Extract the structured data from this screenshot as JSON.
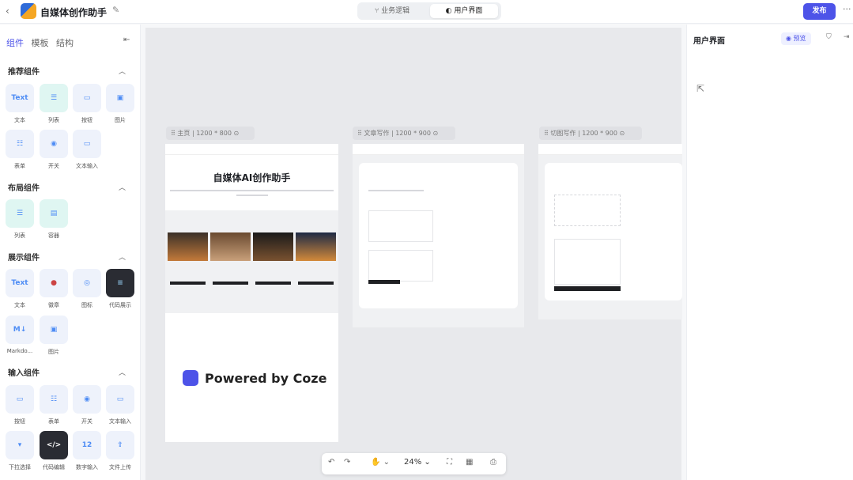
{
  "header": {
    "app_title": "自媒体创作助手",
    "view_tabs": [
      {
        "label": "业务逻辑"
      },
      {
        "label": "用户界面"
      }
    ],
    "publish_label": "发布"
  },
  "panel": {
    "tabs": [
      "组件",
      "模板",
      "结构"
    ],
    "sections": [
      {
        "title": "推荐组件",
        "items": [
          "文本",
          "列表",
          "按钮",
          "图片",
          "表单",
          "开关",
          "文本输入"
        ]
      },
      {
        "title": "布局组件",
        "items": [
          "列表",
          "容器"
        ]
      },
      {
        "title": "展示组件",
        "items": [
          "文本",
          "徽章",
          "图标",
          "代码展示",
          "Markdo...",
          "图片"
        ]
      },
      {
        "title": "输入组件",
        "items": [
          "按钮",
          "表单",
          "开关",
          "文本输入",
          "下拉选择",
          "代码编辑",
          "数字输入",
          "文件上传"
        ]
      }
    ]
  },
  "frames": [
    {
      "name": "主页",
      "size": "1200 * 800",
      "heading": "自媒体AI创作助手",
      "watermark": "Powered by Coze"
    },
    {
      "name": "文章写作",
      "size": "1200 * 900"
    },
    {
      "name": "切图写作",
      "size": "1200 * 900"
    }
  ],
  "right_panel": {
    "title": "用户界面",
    "preview_label": "预览"
  },
  "zoom": {
    "level": "24%"
  }
}
